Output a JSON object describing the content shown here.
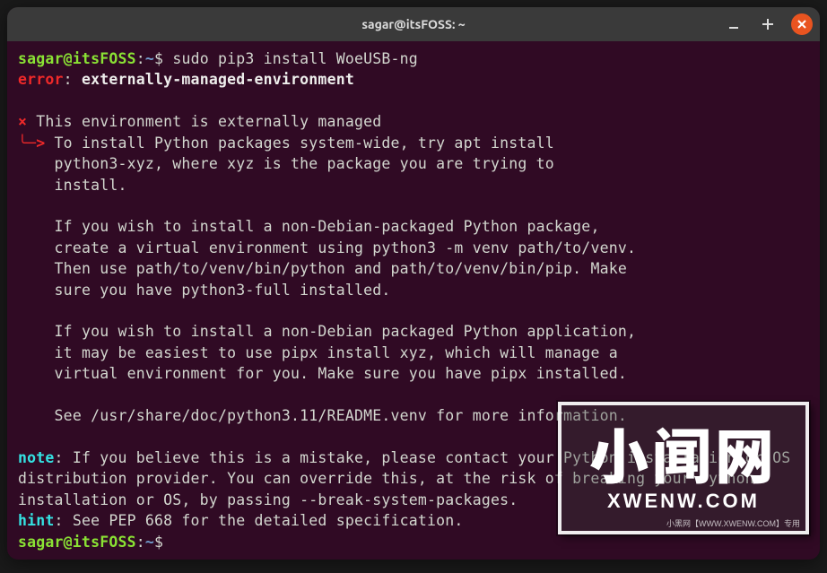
{
  "titlebar": {
    "title": "sagar@itsFOSS: ~"
  },
  "prompt": {
    "user_host": "sagar@itsFOSS",
    "colon": ":",
    "path": "~",
    "dollar": "$"
  },
  "command": "sudo pip3 install WoeUSB-ng",
  "error": {
    "label": "error",
    "sep": ": ",
    "msg": "externally-managed-environment"
  },
  "section_mark": "×",
  "section_title": " This environment is externally managed",
  "arrow": "╰─>",
  "body_lines": [
    " To install Python packages system-wide, try apt install",
    "    python3-xyz, where xyz is the package you are trying to",
    "    install.",
    "    ",
    "    If you wish to install a non-Debian-packaged Python package,",
    "    create a virtual environment using python3 -m venv path/to/venv.",
    "    Then use path/to/venv/bin/python and path/to/venv/bin/pip. Make",
    "    sure you have python3-full installed.",
    "    ",
    "    If you wish to install a non-Debian packaged Python application,",
    "    it may be easiest to use pipx install xyz, which will manage a",
    "    virtual environment for you. Make sure you have pipx installed.",
    "    ",
    "    See /usr/share/doc/python3.11/README.venv for more information."
  ],
  "note": {
    "label": "note",
    "text": ": If you believe this is a mistake, please contact your Python installation or OS distribution provider. You can override this, at the risk of breaking your Python installation or OS, by passing --break-system-packages."
  },
  "hint": {
    "label": "hint",
    "text": ": See PEP 668 for the detailed specification."
  },
  "watermark": {
    "big": "小闻网",
    "small": "XWENW.COM",
    "tiny": "小黑网【WWW.XWENW.COM】专用"
  }
}
